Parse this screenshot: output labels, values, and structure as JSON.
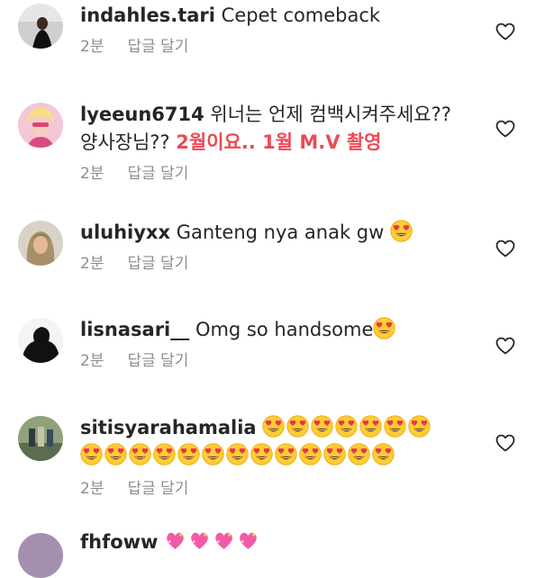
{
  "comments": [
    {
      "username": "indahles.tari",
      "text": "Cepet comeback",
      "time": "2분",
      "reply": "답글 달기"
    },
    {
      "username": "lyeeun6714",
      "text": "위너는 언제 컴백시켜주세요??",
      "text2": "양사장님??",
      "highlight": "2월이요.. 1월 M.V 촬영",
      "time": "2분",
      "reply": "답글 달기"
    },
    {
      "username": "uluhiyxx",
      "text": "Ganteng nya anak gw",
      "emoji": "heart-eyes-emoji",
      "time": "2분",
      "reply": "답글 달기"
    },
    {
      "username": "lisnasari__",
      "text": "Omg so handsome",
      "emoji": "heart-eyes-emoji",
      "time": "2분",
      "reply": "답글 달기"
    },
    {
      "username": "sitisyarahamalia",
      "emoji": "heart-eyes-emoji",
      "emoji_count_line1": 7,
      "emoji_count_line2": 13,
      "time": "2분",
      "reply": "답글 달기"
    },
    {
      "username": "fhfoww",
      "emoji": "sparkling-heart-emoji",
      "emoji_count": 4
    }
  ],
  "icons": {
    "like": "heart-outline-icon"
  },
  "colors": {
    "text": "#262626",
    "meta": "#8e8e8e",
    "highlight": "#ed4956",
    "emoji_face": "#ffcc33",
    "emoji_heart": "#e8344e"
  }
}
